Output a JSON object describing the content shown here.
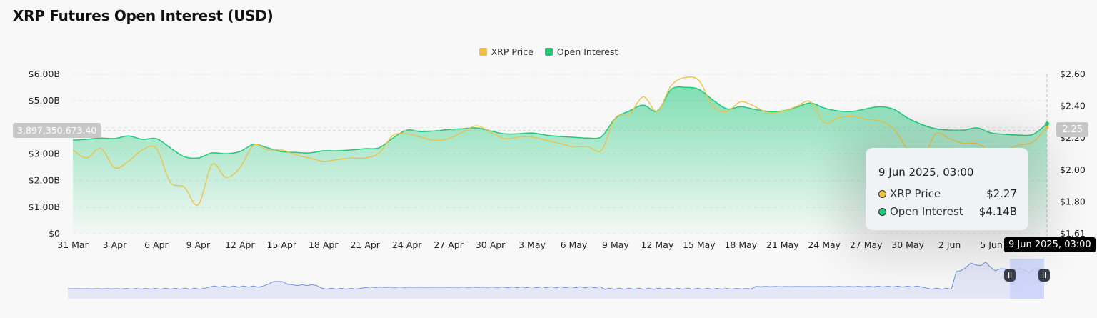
{
  "title": "XRP Futures Open Interest (USD)",
  "legend": [
    {
      "label": "XRP Price",
      "color": "#f0c040"
    },
    {
      "label": "Open Interest",
      "color": "#20c97a"
    }
  ],
  "crosshair": {
    "left_value": "3,897,350,673.40",
    "right_value": "2.25",
    "x_label": "9 Jun 2025, 03:00"
  },
  "tooltip": {
    "date": "9 Jun 2025, 03:00",
    "rows": [
      {
        "label": "XRP Price",
        "value": "$2.27",
        "color": "#f0c040"
      },
      {
        "label": "Open Interest",
        "value": "$4.14B",
        "color": "#20c97a"
      }
    ]
  },
  "chart_data": {
    "type": "area",
    "title": "XRP Futures Open Interest (USD)",
    "x_start": "31 Mar",
    "x_end": "9 Jun",
    "x_step": "1 day",
    "x_ticks": [
      "31 Mar",
      "3 Apr",
      "6 Apr",
      "9 Apr",
      "12 Apr",
      "15 Apr",
      "18 Apr",
      "21 Apr",
      "24 Apr",
      "27 Apr",
      "30 Apr",
      "3 May",
      "6 May",
      "9 May",
      "12 May",
      "15 May",
      "18 May",
      "21 May",
      "24 May",
      "27 May",
      "30 May",
      "2 Jun",
      "5 Jun"
    ],
    "y_left": {
      "ticks": [
        "$0",
        "$1.00B",
        "$2.00B",
        "$3.00B",
        "$4.00B",
        "$5.00B",
        "$6.00B"
      ],
      "range": [
        0,
        6
      ],
      "unit": "USD billions"
    },
    "y_right": {
      "ticks": [
        "$1.61",
        "$1.80",
        "$2.00",
        "$2.20",
        "$2.40",
        "$2.60"
      ],
      "range": [
        1.61,
        2.6
      ],
      "unit": "USD"
    },
    "legend_position": "top-center",
    "grid": true,
    "series": [
      {
        "name": "Open Interest",
        "axis": "left",
        "type": "area",
        "values": [
          3.52,
          3.55,
          3.6,
          3.58,
          3.68,
          3.55,
          3.58,
          3.23,
          2.9,
          2.85,
          3.04,
          3.01,
          3.09,
          3.36,
          3.23,
          3.09,
          3.06,
          3.04,
          3.12,
          3.12,
          3.15,
          3.2,
          3.23,
          3.6,
          3.9,
          3.84,
          3.87,
          3.92,
          3.95,
          3.98,
          3.87,
          3.76,
          3.76,
          3.79,
          3.71,
          3.66,
          3.63,
          3.6,
          3.66,
          4.35,
          4.62,
          4.84,
          4.62,
          5.43,
          5.51,
          5.43,
          5.03,
          4.7,
          4.78,
          4.68,
          4.6,
          4.62,
          4.76,
          4.92,
          4.73,
          4.62,
          4.6,
          4.7,
          4.78,
          4.68,
          4.35,
          4.11,
          3.95,
          3.9,
          3.9,
          3.98,
          3.79,
          3.74,
          3.71,
          3.74,
          4.14
        ]
      },
      {
        "name": "XRP Price",
        "axis": "right",
        "type": "line",
        "values": [
          2.13,
          2.08,
          2.14,
          2.02,
          2.06,
          2.13,
          2.14,
          1.93,
          1.9,
          1.79,
          2.04,
          1.96,
          2.02,
          2.16,
          2.13,
          2.13,
          2.1,
          2.08,
          2.06,
          2.07,
          2.08,
          2.08,
          2.11,
          2.22,
          2.23,
          2.21,
          2.19,
          2.2,
          2.24,
          2.28,
          2.24,
          2.2,
          2.21,
          2.21,
          2.19,
          2.17,
          2.15,
          2.15,
          2.13,
          2.33,
          2.35,
          2.46,
          2.37,
          2.53,
          2.58,
          2.56,
          2.4,
          2.37,
          2.43,
          2.4,
          2.36,
          2.37,
          2.4,
          2.43,
          2.3,
          2.33,
          2.34,
          2.32,
          2.31,
          2.26,
          2.13,
          2.06,
          2.23,
          2.2,
          2.17,
          2.17,
          2.12,
          2.13,
          2.16,
          2.18,
          2.27
        ]
      }
    ]
  }
}
